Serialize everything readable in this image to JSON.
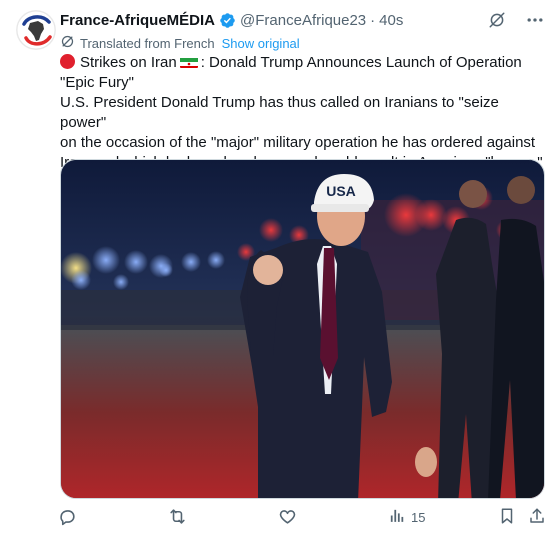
{
  "author": {
    "display_name": "France-AfriqueMÉDIA",
    "handle": "@FranceAfrique23",
    "separator": "·",
    "time": "40s",
    "verified_icon": "verified-badge-icon",
    "avatar_icon": "africa-map-logo"
  },
  "translation": {
    "note": "Translated from French",
    "show_original": "Show original"
  },
  "tweet": {
    "headline": "Strikes on Iran",
    "headline_rest": ": Donald Trump Announces Launch of Operation \"Epic Fury\"",
    "body_line_1": "U.S. President Donald Trump has thus called on Iranians to \"seize power\"",
    "body_line_2": "on the occasion of the \"major\" military operation he has ordered against",
    "body_line_3": "Iran, and which he has already warned could result in American \"losses.\""
  },
  "media": {
    "cap_text": "USA",
    "description_icon": "photo"
  },
  "actions": {
    "reply_icon": "reply-icon",
    "repost_icon": "repost-icon",
    "like_icon": "like-icon",
    "views_icon": "views-icon",
    "views_count": "15",
    "bookmark_icon": "bookmark-icon",
    "share_icon": "share-icon"
  },
  "colors": {
    "text": "#0f1419",
    "secondary": "#536471",
    "link": "#1d9bf0",
    "verified": "#1d9bf0"
  }
}
